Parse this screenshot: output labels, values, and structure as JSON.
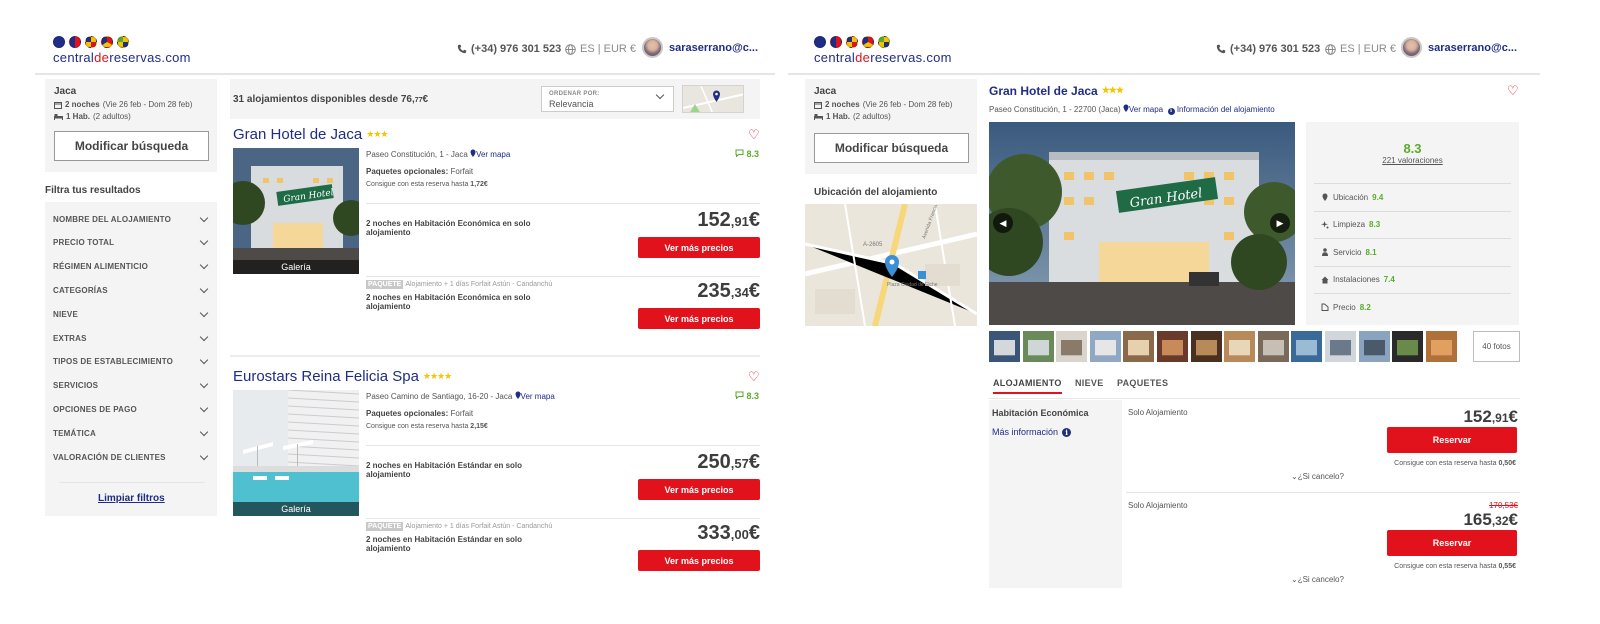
{
  "colors": {
    "brand_blue": "#1f2d86",
    "brand_red": "#e2121c",
    "score_green": "#5aab2b",
    "star_yellow": "#f4c400"
  },
  "header": {
    "logo_a": "central",
    "logo_b": "de",
    "logo_c": "reservas.com",
    "phone": "(+34) 976 301 523",
    "lang_currency": "ES | EUR €",
    "user": "saraserrano@c..."
  },
  "search": {
    "destination": "Jaca",
    "nights": "2 noches",
    "dates": "(Vie 26 feb - Dom 28 feb)",
    "rooms": "1 Hab.",
    "guests": "(2 adultos)",
    "modify_label": "Modificar búsqueda"
  },
  "filters": {
    "title": "Filtra tus resultados",
    "items": [
      "NOMBRE DEL ALOJAMIENTO",
      "PRECIO TOTAL",
      "RÉGIMEN ALIMENTICIO",
      "CATEGORÍAS",
      "NIEVE",
      "EXTRAS",
      "TIPOS DE ESTABLECIMIENTO",
      "SERVICIOS",
      "OPCIONES DE PAGO",
      "TEMÁTICA",
      "VALORACIÓN DE CLIENTES"
    ],
    "clear_label": "Limpiar filtros"
  },
  "results": {
    "count": "31 alojamientos disponibles desde 76,",
    "count_dec": "77",
    "count_cur": "€",
    "sort_label": "ORDENAR POR:",
    "sort_value": "Relevancia"
  },
  "hotels": [
    {
      "name": "Gran Hotel de Jaca",
      "stars": "★★★",
      "address": "Paseo Constitución, 1 - Jaca",
      "map_link": "Ver mapa",
      "score": "8.3",
      "gallery_label": "Galería",
      "packages_label": "Paquetes opcionales:",
      "packages_value": "Forfait",
      "discount_text": "Consigue con esta reserva hasta",
      "discount_value": "1,72€",
      "offers": [
        {
          "paquete_tag": "",
          "paquete_text": "",
          "room": "2 noches en Habitación Económica en solo alojamiento",
          "price_int": "152",
          "price_dec": ",91",
          "price_cur": "€",
          "button": "Ver más precios"
        },
        {
          "paquete_tag": "PAQUETE",
          "paquete_text": "Alojamiento + 1 días Forfait Astún - Candanchú",
          "room": "2 noches en Habitación Económica en solo alojamiento",
          "price_int": "235",
          "price_dec": ",34",
          "price_cur": "€",
          "button": "Ver más precios"
        }
      ]
    },
    {
      "name": "Eurostars Reina Felicia Spa",
      "stars": "★★★★",
      "address": "Paseo Camino de Santiago, 16-20 - Jaca",
      "map_link": "Ver mapa",
      "score": "8.3",
      "gallery_label": "Galería",
      "packages_label": "Paquetes opcionales:",
      "packages_value": "Forfait",
      "discount_text": "Consigue con esta reserva hasta",
      "discount_value": "2,15€",
      "offers": [
        {
          "paquete_tag": "",
          "paquete_text": "",
          "room": "2 noches en Habitación Estándar en solo alojamiento",
          "price_int": "250",
          "price_dec": ",57",
          "price_cur": "€",
          "button": "Ver más precios"
        },
        {
          "paquete_tag": "PAQUETE",
          "paquete_text": "Alojamiento + 1 días Forfait Astún - Candanchú",
          "room": "2 noches en Habitación Estándar en solo alojamiento",
          "price_int": "333",
          "price_dec": ",00",
          "price_cur": "€",
          "button": "Ver más precios"
        }
      ]
    }
  ],
  "detail": {
    "name": "Gran Hotel de Jaca",
    "stars": "★★★",
    "address": "Paseo Constitución, 1 - 22700 (Jaca)",
    "map_link": "Ver mapa",
    "info_link": "Información del alojamiento",
    "location_title": "Ubicación del alojamiento",
    "map_road": "A-2605",
    "map_street": "Avenida Francia",
    "map_square": "Plaza Ciudad de Elche",
    "score": "8.3",
    "reviews": "221 valoraciones",
    "categories": [
      {
        "icon": "location-icon",
        "label": "Ubicación",
        "value": "9.4"
      },
      {
        "icon": "sparkle-icon",
        "label": "Limpieza",
        "value": "8.3"
      },
      {
        "icon": "staff-icon",
        "label": "Servicio",
        "value": "8.1"
      },
      {
        "icon": "home-icon",
        "label": "Instalaciones",
        "value": "7.4"
      },
      {
        "icon": "price-tag-icon",
        "label": "Precio",
        "value": "8.2"
      }
    ],
    "photo_sign": "Gran Hotel",
    "photos_count": "40 fotos",
    "tabs": [
      "ALOJAMIENTO",
      "NIEVE",
      "PAQUETES"
    ],
    "room_title": "Habitación Económica",
    "room_more": "Más información",
    "options": [
      {
        "name": "Solo Alojamiento",
        "old_price": "",
        "price_int": "152",
        "price_dec": ",91",
        "price_cur": "€",
        "button": "Reservar",
        "note": "Consigue con esta reserva hasta",
        "note_value": "0,50€",
        "cancel": "¿Si cancelo?"
      },
      {
        "name": "Solo Alojamiento",
        "old_price": "170,53€",
        "price_int": "165",
        "price_dec": ",32",
        "price_cur": "€",
        "button": "Reservar",
        "note": "Consigue con esta reserva hasta",
        "note_value": "0,55€",
        "cancel": "¿Si cancelo?"
      }
    ]
  }
}
